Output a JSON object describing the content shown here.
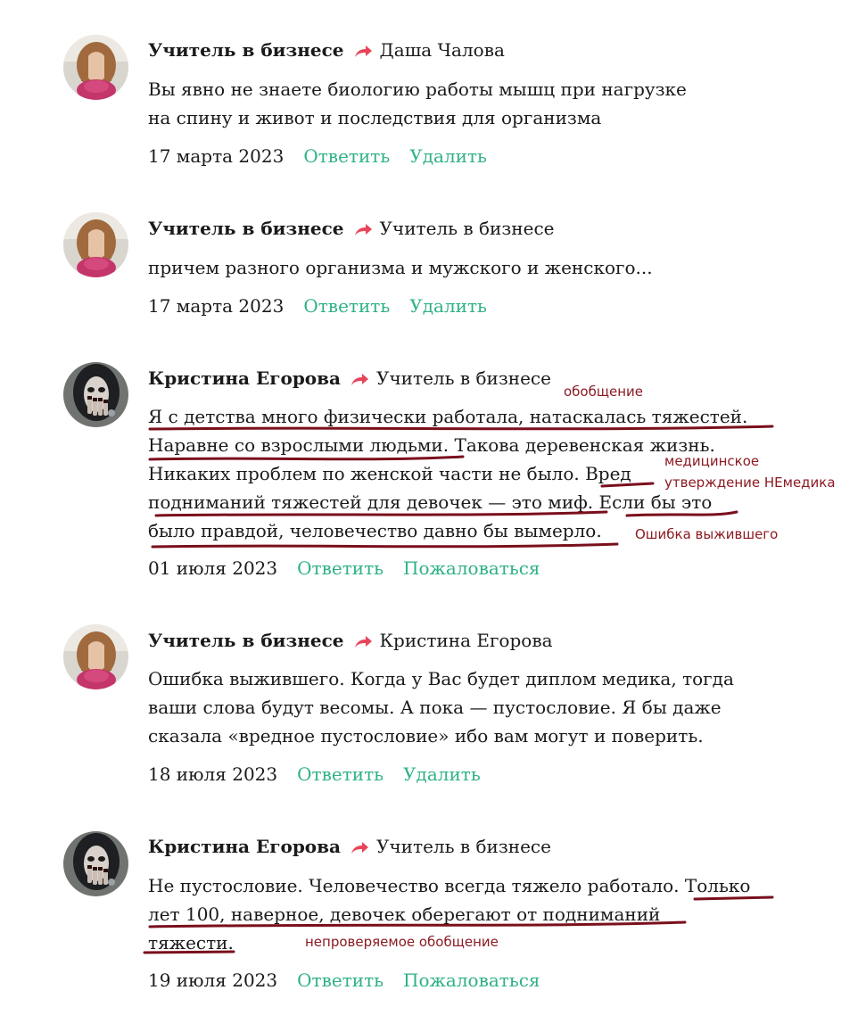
{
  "comments": [
    {
      "author": "Учитель в бизнесе",
      "reply_to": "Даша Чалова",
      "lines": [
        "Вы явно не знаете биологию работы мышц при нагрузке",
        "на спину и живот и последствия для организма"
      ],
      "date": "17 марта 2023",
      "action1": "Ответить",
      "action2": "Удалить"
    },
    {
      "author": "Учитель в бизнесе",
      "reply_to": "Учитель в бизнесе",
      "lines": [
        "причем разного организма и мужского и женского..."
      ],
      "date": "17 марта 2023",
      "action1": "Ответить",
      "action2": "Удалить"
    },
    {
      "author": "Кристина Егорова",
      "reply_to": "Учитель в бизнесе",
      "lines": [
        "Я с детства много физически работала, натаскалась тяжестей.",
        "Наравне со взрослыми людьми. Такова деревенская жизнь.",
        "Никаких проблем по женской части не было. Вред",
        "подниманий тяжестей для девочек — это миф. Если бы это",
        "было правдой, человечество давно бы вымерло."
      ],
      "date": "01 июля 2023",
      "action1": "Ответить",
      "action2": "Пожаловаться"
    },
    {
      "author": "Учитель в бизнесе",
      "reply_to": "Кристина Егорова",
      "lines": [
        "Ошибка выжившего. Когда у Вас будет диплом медика, тогда",
        "ваши слова будут весомы. А пока — пустословие. Я бы даже",
        "сказала «вредное пустословие» ибо вам могут и поверить."
      ],
      "date": "18 июля 2023",
      "action1": "Ответить",
      "action2": "Удалить"
    },
    {
      "author": "Кристина Егорова",
      "reply_to": "Учитель в бизнесе",
      "lines": [
        "Не пустословие. Человечество всегда тяжело работало. Только",
        "лет 100, наверное, девочек оберегают от подниманий",
        "тяжести."
      ],
      "date": "19 июля 2023",
      "action1": "Ответить",
      "action2": "Пожаловаться"
    }
  ],
  "annotations": {
    "generalization": "обобщение",
    "medical_claim_1": "медицинское",
    "medical_claim_2": "утверждение НЕмедика",
    "survivor_bias": "Ошибка выжившего",
    "unverifiable": "непроверяемое обобщение"
  },
  "colors": {
    "accent_link": "#2fb283",
    "reply_arrow": "#e8455a",
    "annotation": "#8b1a22"
  }
}
